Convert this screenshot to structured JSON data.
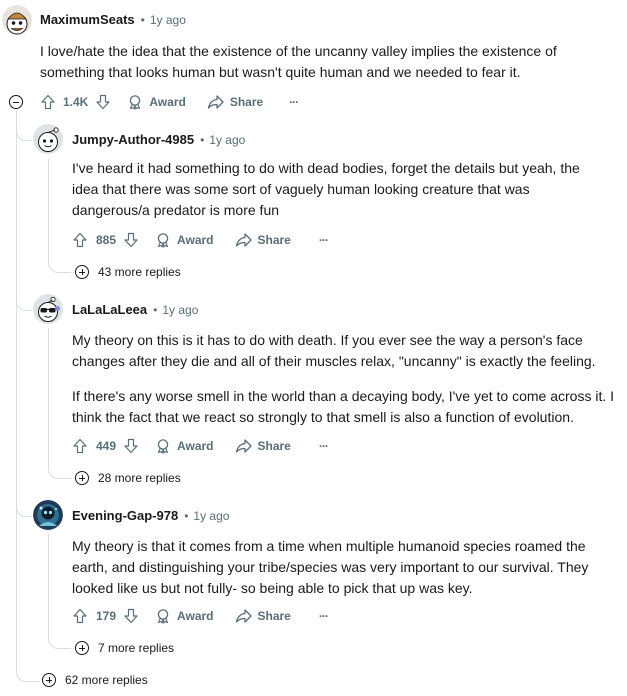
{
  "root": {
    "author": "MaximumSeats",
    "age": "1y ago",
    "separator": "•",
    "body": "I love/hate the idea that the existence of the uncanny valley implies the existence of something that looks human but wasn't quite human and we needed to fear it.",
    "votes": "1.4K",
    "award_label": "Award",
    "share_label": "Share",
    "more_label": "···",
    "more_replies": "62 more replies"
  },
  "replies": [
    {
      "author": "Jumpy-Author-4985",
      "age": "1y ago",
      "separator": "•",
      "paragraphs": [
        "I've heard it had something to do with dead bodies, forget the details but yeah, the idea that there was some sort of vaguely human looking creature that was dangerous/a predator is more fun"
      ],
      "votes": "885",
      "award_label": "Award",
      "share_label": "Share",
      "more_label": "···",
      "more_replies": "43 more replies"
    },
    {
      "author": "LaLaLaLeea",
      "age": "1y ago",
      "separator": "•",
      "paragraphs": [
        "My theory on this is it has to do with death.  If you ever see the way a person's face changes after they die and all of their muscles relax, \"uncanny\" is exactly the feeling.",
        "If there's any worse smell in the world than a decaying body, I've yet to come across it.  I think the fact that we react so strongly to that smell is also a function of evolution."
      ],
      "votes": "449",
      "award_label": "Award",
      "share_label": "Share",
      "more_label": "···",
      "more_replies": "28 more replies"
    },
    {
      "author": "Evening-Gap-978",
      "age": "1y ago",
      "separator": "•",
      "paragraphs": [
        "My theory is that it comes from a time when multiple humanoid species roamed the earth, and distinguishing your tribe/species was very important to our survival. They looked like us but not fully- so being able to pick that up was key."
      ],
      "votes": "179",
      "award_label": "Award",
      "share_label": "Share",
      "more_label": "···",
      "more_replies": "7 more replies"
    }
  ],
  "icons": {
    "upvote": "upvote-arrow-icon",
    "downvote": "downvote-arrow-icon",
    "award": "award-icon",
    "share": "share-icon",
    "collapse": "collapse-minus-icon",
    "expand": "expand-plus-icon"
  },
  "colors": {
    "meta_text": "#576f76",
    "primary_text": "#1a1a1b",
    "thread_line": "#d9dde0"
  }
}
